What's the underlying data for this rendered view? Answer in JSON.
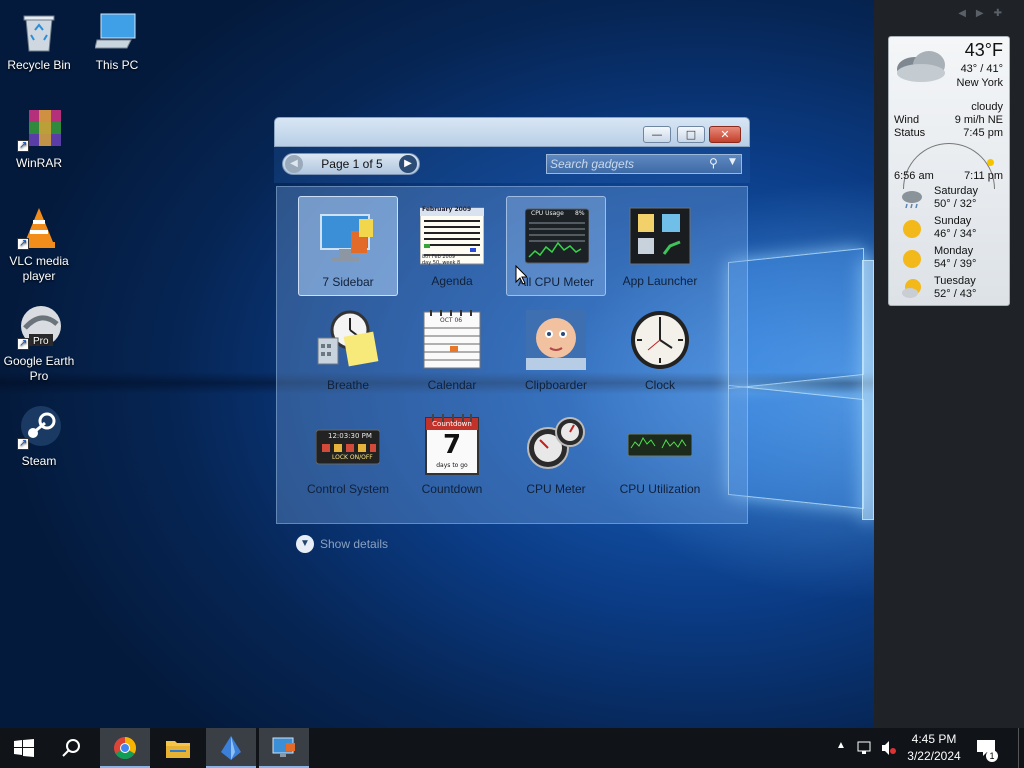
{
  "desktop": {
    "icons": [
      {
        "label": "Recycle Bin",
        "icon": "recycle-bin-icon"
      },
      {
        "label": "This PC",
        "icon": "this-pc-icon"
      },
      {
        "label": "WinRAR",
        "icon": "winrar-icon"
      },
      {
        "label": "VLC media player",
        "icon": "vlc-icon"
      },
      {
        "label": "Google Earth Pro",
        "icon": "google-earth-icon"
      },
      {
        "label": "Steam",
        "icon": "steam-icon"
      }
    ],
    "google_earth_badge": "Pro"
  },
  "gallery": {
    "pager_text": "Page 1 of 5",
    "search_placeholder": "Search gadgets",
    "show_details": "Show details",
    "gadgets": [
      {
        "label": "7 Sidebar",
        "icon": "sidebar-gadget-icon",
        "state": "selected"
      },
      {
        "label": "Agenda",
        "icon": "agenda-gadget-icon",
        "state": "normal"
      },
      {
        "label": "All CPU Meter",
        "icon": "cpu-meter-gadget-icon",
        "state": "hover"
      },
      {
        "label": "App Launcher",
        "icon": "app-launcher-gadget-icon",
        "state": "normal"
      },
      {
        "label": "Breathe",
        "icon": "breathe-gadget-icon",
        "state": "normal"
      },
      {
        "label": "Calendar",
        "icon": "calendar-gadget-icon",
        "state": "normal"
      },
      {
        "label": "Clipboarder",
        "icon": "clipboarder-gadget-icon",
        "state": "normal"
      },
      {
        "label": "Clock",
        "icon": "clock-gadget-icon",
        "state": "normal"
      },
      {
        "label": "Control System",
        "icon": "control-system-gadget-icon",
        "state": "normal"
      },
      {
        "label": "Countdown",
        "icon": "countdown-gadget-icon",
        "state": "normal"
      },
      {
        "label": "CPU Meter",
        "icon": "cpu-gauge-gadget-icon",
        "state": "normal"
      },
      {
        "label": "CPU Utilization",
        "icon": "cpu-utilization-gadget-icon",
        "state": "normal"
      }
    ],
    "thumb_text": {
      "agenda_header": "February 2009",
      "agenda_footer": "8th Feb 2009",
      "agenda_footer2": "day 50, week 8",
      "cpu_title": "CPU Usage",
      "cpu_pct": "8%",
      "calendar_header": "OCT 06",
      "control_time": "12:03:30 PM",
      "control_lock": "LOCK ON/OFF",
      "countdown_title": "Countdown",
      "countdown_number": "7",
      "countdown_sub": "days to go"
    }
  },
  "weather": {
    "temp": "43°F",
    "hilo": "43° / 41°",
    "city": "New York",
    "condition": "cloudy",
    "wind_label": "Wind",
    "wind_value": "9 mi/h NE",
    "status_label": "Status",
    "status_value": "7:45 pm",
    "sunrise": "6:56 am",
    "sunset": "7:11 pm",
    "forecast": [
      {
        "day": "Saturday",
        "temps": "50° / 32°",
        "icon": "cloud-rain-icon"
      },
      {
        "day": "Sunday",
        "temps": "46° / 34°",
        "icon": "sun-icon"
      },
      {
        "day": "Monday",
        "temps": "54° / 39°",
        "icon": "sun-icon"
      },
      {
        "day": "Tuesday",
        "temps": "52° / 43°",
        "icon": "sun-cloud-icon"
      }
    ]
  },
  "taskbar": {
    "time": "4:45 PM",
    "date": "3/22/2024",
    "notification_count": "1",
    "apps": [
      "start-icon",
      "search-icon",
      "chrome-icon",
      "file-explorer-icon",
      "crystal-app-icon",
      "gadgets-app-icon"
    ]
  },
  "colors": {
    "accent": "#1b66c4",
    "taskbar": "#101418",
    "sidebar": "#1f2328"
  }
}
